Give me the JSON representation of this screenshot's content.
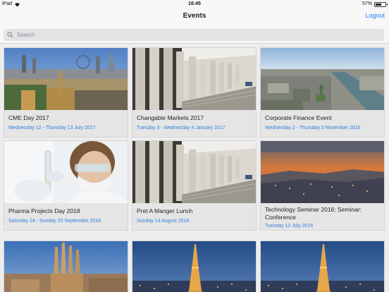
{
  "status": {
    "device": "iPad",
    "time": "16:45",
    "battery_text": "57%",
    "battery_level": 0.57
  },
  "nav": {
    "title": "Events",
    "logout_label": "Logout"
  },
  "search": {
    "placeholder": "Search"
  },
  "colors": {
    "accent": "#1a7ef0",
    "date_text": "#2d7fe0"
  },
  "events": [
    {
      "title": "CME Day 2017",
      "date": "Wednesday 12 - Thursday 13 July 2017",
      "image": "london-skyline"
    },
    {
      "title": "Changable Markets 2017",
      "date": "Tuesday 3 - Wednesday 4 January 2017",
      "image": "columns-building"
    },
    {
      "title": "Corporate Finance Event",
      "date": "Wednesday 2 - Thursday 3 November 2016",
      "image": "city-river-aerial"
    },
    {
      "title": "Pharma Projects Day 2018",
      "date": "Saturday 24 - Sunday 25 September 2016",
      "image": "lab-scientist"
    },
    {
      "title": "Pret A Manger Lunch",
      "date": "Sunday 14 August 2016",
      "image": "columns-building"
    },
    {
      "title": "Technology Seminar 2016: Seminar: Conference",
      "date": "Tuesday 12 July 2016",
      "image": "city-sunset"
    },
    {
      "title": "",
      "date": "",
      "image": "sagrada-familia"
    },
    {
      "title": "",
      "date": "",
      "image": "eiffel-tower-night"
    },
    {
      "title": "",
      "date": "",
      "image": "eiffel-tower-night"
    }
  ]
}
